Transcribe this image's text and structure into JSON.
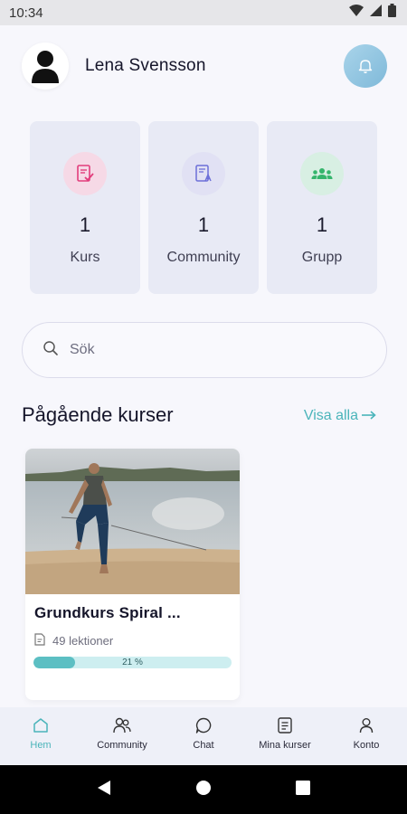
{
  "status_bar": {
    "time": "10:34"
  },
  "user": {
    "name": "Lena Svensson"
  },
  "stats": [
    {
      "count": "1",
      "label": "Kurs",
      "icon": "course-icon",
      "bg": "#f6d9e6",
      "fg": "#e23d7c"
    },
    {
      "count": "1",
      "label": "Community",
      "icon": "community-doc-icon",
      "bg": "#e1e1f4",
      "fg": "#6c6fd8"
    },
    {
      "count": "1",
      "label": "Grupp",
      "icon": "group-icon",
      "bg": "#d8efe3",
      "fg": "#35b56c"
    }
  ],
  "search": {
    "placeholder": "Sök"
  },
  "ongoing": {
    "title": "Pågående kurser",
    "see_all": "Visa alla",
    "courses": [
      {
        "title": "Grundkurs Spiral ...",
        "lessons": "49 lektioner",
        "progress_label": "21 %",
        "progress": 21
      }
    ]
  },
  "tabs": [
    {
      "label": "Hem",
      "icon": "home-icon",
      "active": true
    },
    {
      "label": "Community",
      "icon": "community-icon",
      "active": false
    },
    {
      "label": "Chat",
      "icon": "chat-icon",
      "active": false
    },
    {
      "label": "Mina kurser",
      "icon": "my-courses-icon",
      "active": false
    },
    {
      "label": "Konto",
      "icon": "account-icon",
      "active": false
    }
  ],
  "colors": {
    "accent": "#4ab4ba",
    "progress_track": "#cdeef0",
    "progress_fill": "#5cbfc3"
  }
}
